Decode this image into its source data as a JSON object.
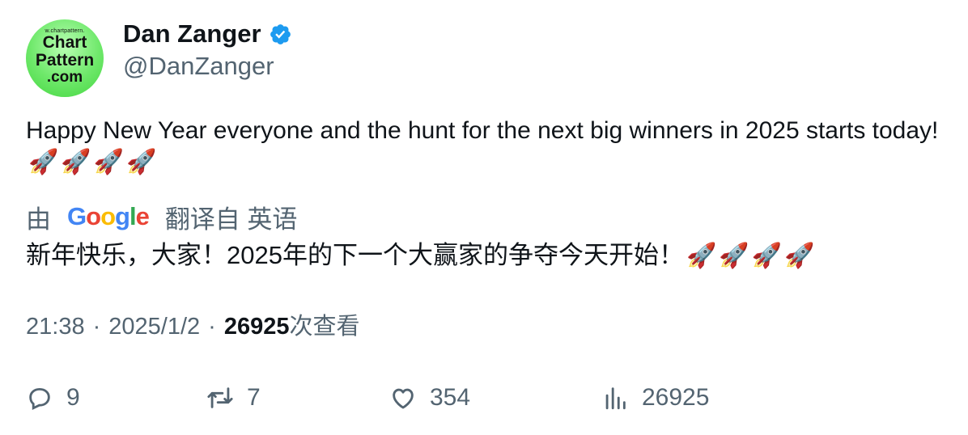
{
  "author": {
    "name": "Dan Zanger",
    "handle": "@DanZanger",
    "avatar_text_small": "w.chartpattern.",
    "avatar_text_line1": "Chart",
    "avatar_text_line2": "Pattern",
    "avatar_text_line3": ".com"
  },
  "tweet": {
    "text": "Happy New Year everyone and the hunt for the next big winners in 2025 starts today! ",
    "emojis": [
      "🚀",
      "🚀",
      "🚀",
      "🚀"
    ]
  },
  "translation": {
    "by_label": "由",
    "provider": "Google",
    "from_label": "翻译自 英语",
    "text": "新年快乐，大家！2025年的下一个大赢家的争夺今天开始！",
    "emojis": [
      "🚀",
      "🚀",
      "🚀",
      "🚀"
    ]
  },
  "meta": {
    "time": "21:38",
    "separator": "·",
    "date": "2025/1/2",
    "views_count": "26925",
    "views_label": "次查看"
  },
  "actions": {
    "replies": "9",
    "reposts": "7",
    "likes": "354",
    "views": "26925"
  },
  "colors": {
    "text": "#0f1419",
    "secondary": "#536471",
    "verified": "#1d9bf0",
    "google_blue": "#4285F4",
    "google_red": "#EA4335",
    "google_yellow": "#FBBC05",
    "google_green": "#34A853"
  },
  "icons": {
    "verified": "verified-badge-icon",
    "reply": "reply-icon",
    "repost": "repost-icon",
    "like": "heart-icon",
    "views": "bar-chart-icon"
  }
}
